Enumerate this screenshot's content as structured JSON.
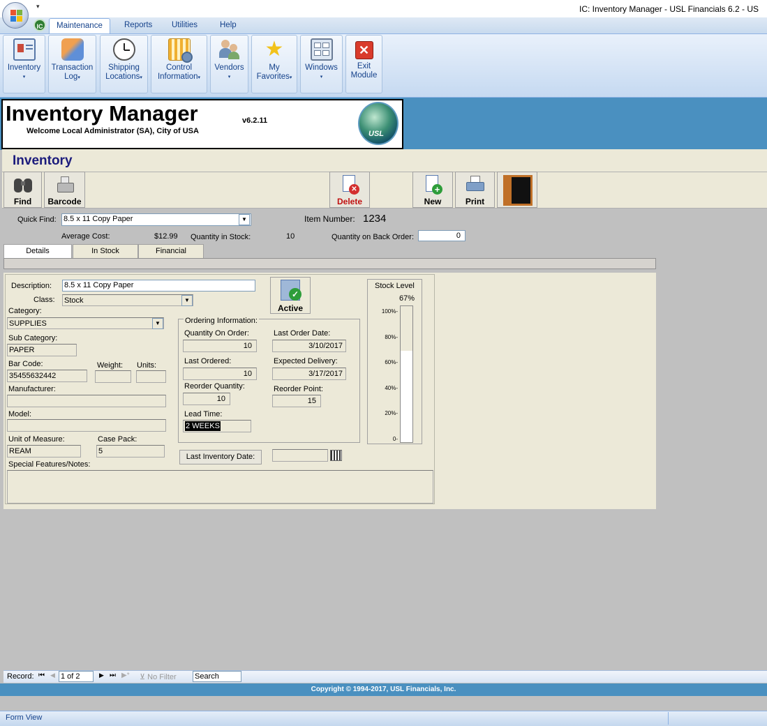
{
  "window": {
    "title": "IC: Inventory Manager - USL Financials 6.2 - US",
    "qat_arrow": "▾"
  },
  "ribbon": {
    "ic_label": "IC",
    "tabs": [
      {
        "label": "Maintenance"
      },
      {
        "label": "Reports"
      },
      {
        "label": "Utilities"
      },
      {
        "label": "Help"
      }
    ],
    "buttons": [
      {
        "line1": "Inventory",
        "line2": "",
        "dropdown": true
      },
      {
        "line1": "Transaction",
        "line2": "Log",
        "dropdown": true
      },
      {
        "line1": "Shipping",
        "line2": "Locations",
        "dropdown": true
      },
      {
        "line1": "Control",
        "line2": "Information",
        "dropdown": true
      },
      {
        "line1": "Vendors",
        "line2": "",
        "dropdown": true
      },
      {
        "line1": "My",
        "line2": "Favorites",
        "dropdown": true
      },
      {
        "line1": "Windows",
        "line2": "",
        "dropdown": true
      },
      {
        "line1": "Exit",
        "line2": "Module",
        "dropdown": false
      }
    ]
  },
  "header": {
    "app_name": "Inventory Manager",
    "welcome": "Welcome Local Administrator (SA), City of USA",
    "version": "v6.2.11",
    "logo_text": "USL"
  },
  "form": {
    "title": "Inventory",
    "toolbar": {
      "find": "Find",
      "barcode": "Barcode",
      "delete": "Delete",
      "new": "New",
      "print": "Print"
    },
    "quick_find_label": "Quick Find:",
    "quick_find_value": "8.5 x 11 Copy Paper",
    "item_number_label": "Item Number:",
    "item_number_value": "1234",
    "average_cost_label": "Average Cost:",
    "average_cost_value": "$12.99",
    "qty_in_stock_label": "Quantity in Stock:",
    "qty_in_stock_value": "10",
    "qty_back_order_label": "Quantity on Back Order:",
    "qty_back_order_value": "0",
    "tabs": [
      {
        "label": "Details"
      },
      {
        "label": "In Stock"
      },
      {
        "label": "Financial"
      }
    ]
  },
  "details": {
    "description_label": "Description:",
    "description_value": "8.5 x 11 Copy Paper",
    "class_label": "Class:",
    "class_value": "Stock",
    "active_label": "Active",
    "category_label": "Category:",
    "category_value": "SUPPLIES",
    "sub_category_label": "Sub Category:",
    "sub_category_value": "PAPER",
    "bar_code_label": "Bar Code:",
    "bar_code_value": "35455632442",
    "weight_label": "Weight:",
    "weight_value": "",
    "units_label": "Units:",
    "units_value": "",
    "manufacturer_label": "Manufacturer:",
    "manufacturer_value": "",
    "model_label": "Model:",
    "model_value": "",
    "uom_label": "Unit of Measure:",
    "uom_value": "REAM",
    "case_pack_label": "Case Pack:",
    "case_pack_value": "5",
    "notes_label": "Special Features/Notes:",
    "notes_value": "",
    "last_inventory_button": "Last Inventory Date:",
    "last_inventory_value": ""
  },
  "ordering": {
    "group_label": "Ordering Information:",
    "qty_on_order_label": "Quantity On Order:",
    "qty_on_order_value": "10",
    "last_order_date_label": "Last Order Date:",
    "last_order_date_value": "3/10/2017",
    "last_ordered_label": "Last Ordered:",
    "last_ordered_value": "10",
    "expected_delivery_label": "Expected Delivery:",
    "expected_delivery_value": "3/17/2017",
    "reorder_qty_label": "Reorder Quantity:",
    "reorder_qty_value": "10",
    "reorder_point_label": "Reorder Point:",
    "reorder_point_value": "15",
    "lead_time_label": "Lead Time:",
    "lead_time_value": "2 WEEKS"
  },
  "stock_level": {
    "title": "Stock Level",
    "percent_label": "67%",
    "fraction": 0.67,
    "ticks": [
      "100%-",
      "80%-",
      "60%-",
      "40%-",
      "20%-",
      "0-"
    ]
  },
  "navbar": {
    "record_label": "Record:",
    "record_value": "1 of 2",
    "no_filter": "No Filter",
    "search": "Search"
  },
  "footer": {
    "copyright": "Copyright © 1994-2017, USL Financials, Inc."
  },
  "status": {
    "text": "Form View"
  }
}
